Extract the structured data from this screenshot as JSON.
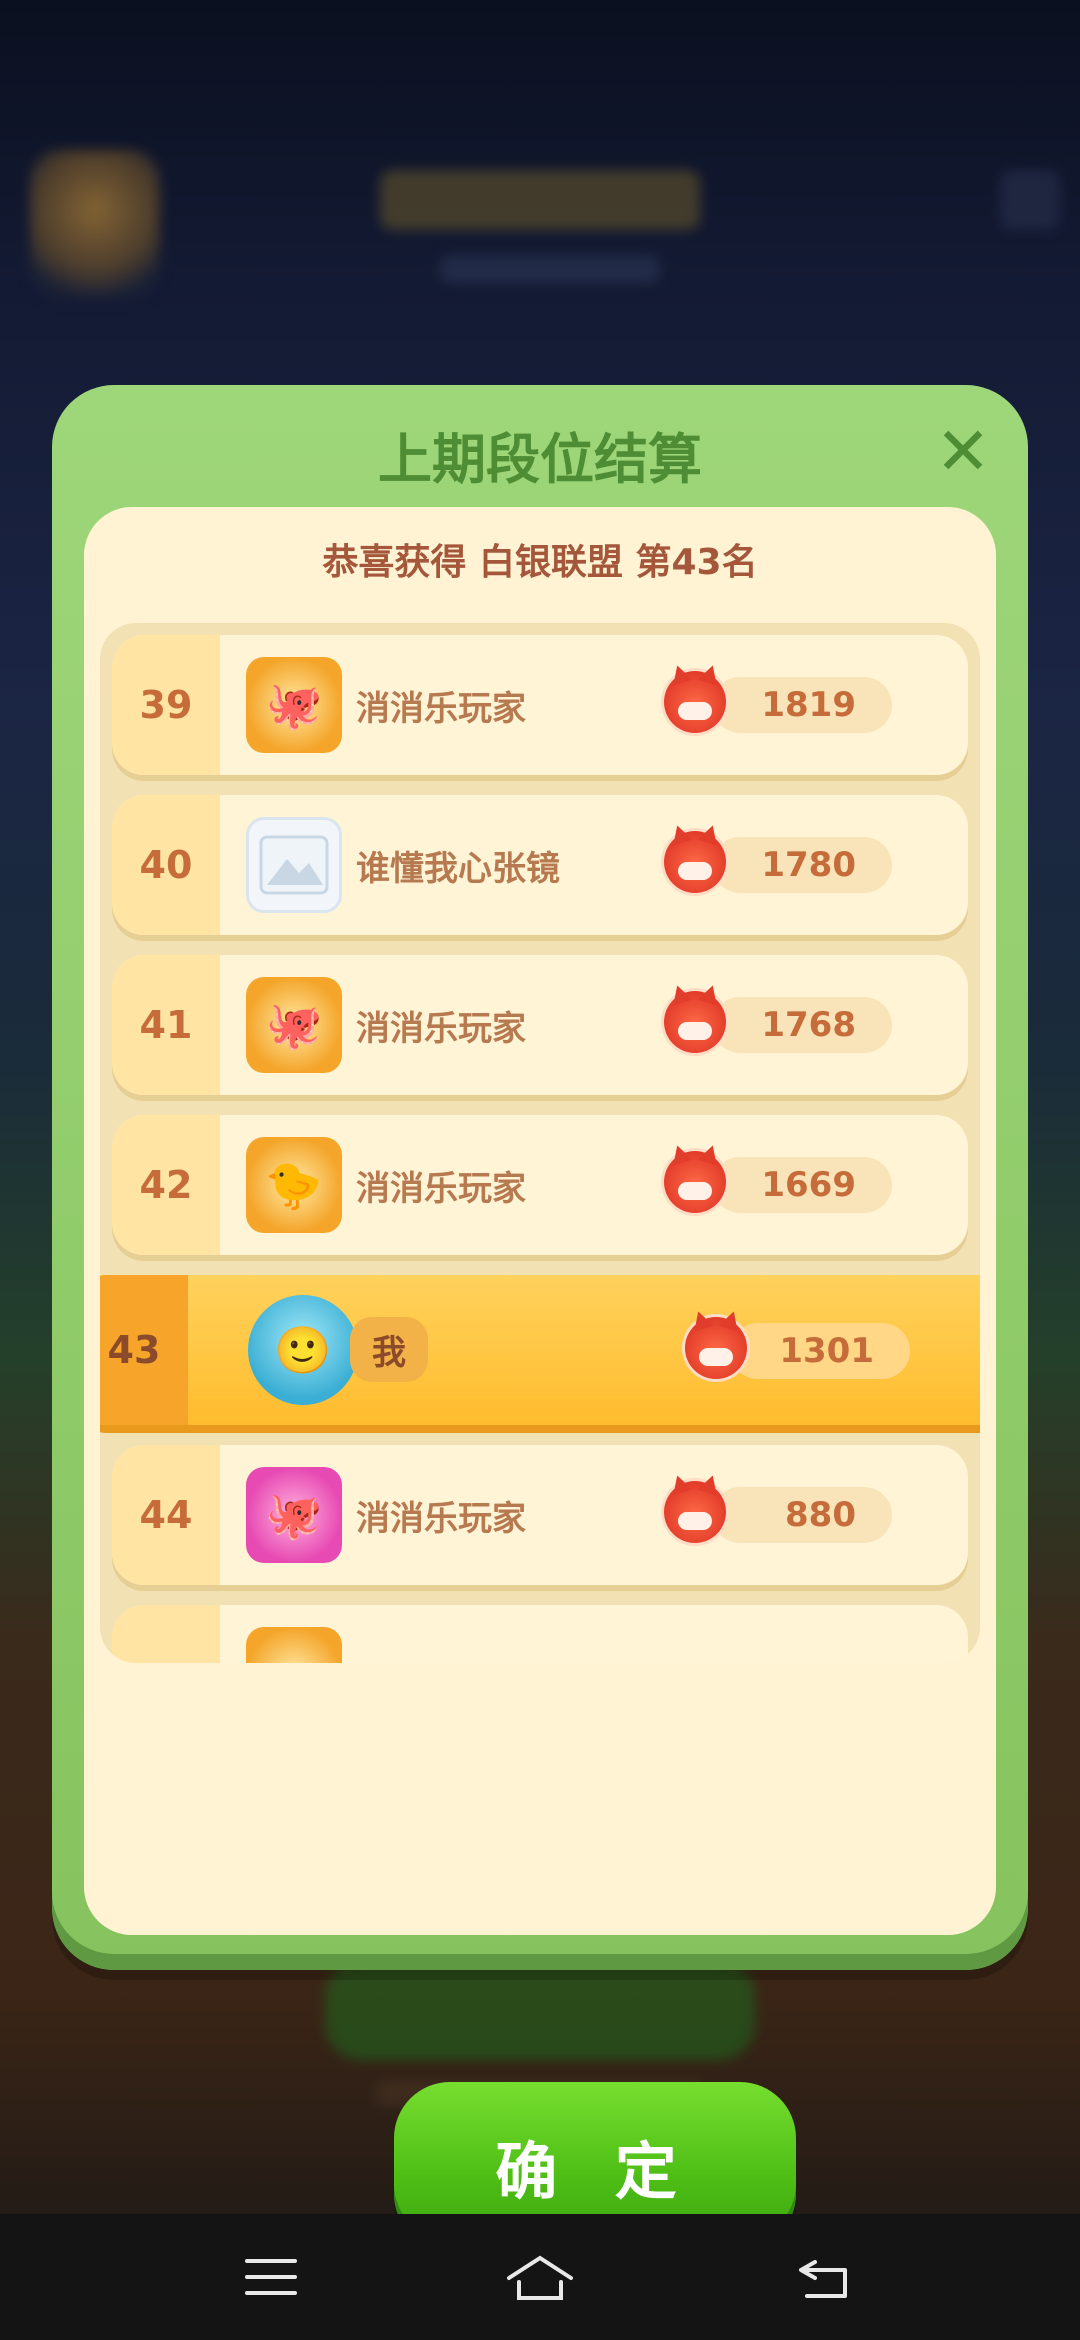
{
  "dialog": {
    "title": "上期段位结算",
    "congrats": "恭喜获得 白银联盟 第43名",
    "confirm_label": "确 定"
  },
  "ranking": {
    "rows": [
      {
        "rank": "39",
        "name": "消消乐玩家",
        "score": "1819",
        "avatar_icon": "octopus-badge-icon"
      },
      {
        "rank": "40",
        "name": "谁懂我心张镜",
        "score": "1780",
        "avatar_icon": "image-placeholder-icon"
      },
      {
        "rank": "41",
        "name": "消消乐玩家",
        "score": "1768",
        "avatar_icon": "octopus-badge-icon"
      },
      {
        "rank": "42",
        "name": "消消乐玩家",
        "score": "1669",
        "avatar_icon": "chick-badge-icon"
      },
      {
        "rank": "43",
        "name": "我",
        "score": "1301",
        "avatar_icon": "user-photo-avatar",
        "highlighted": true
      },
      {
        "rank": "44",
        "name": "消消乐玩家",
        "score": "880",
        "avatar_icon": "octopus-icon"
      }
    ]
  },
  "colors": {
    "dialog_green": "#9ed67a",
    "panel_cream": "#fff3d4",
    "rank_text": "#c66b3a",
    "highlight": "#ffbc2e",
    "confirm_green": "#4fbf16"
  },
  "navbar": {
    "menu_icon": "menu-icon",
    "home_icon": "home-icon",
    "back_icon": "back-icon"
  }
}
